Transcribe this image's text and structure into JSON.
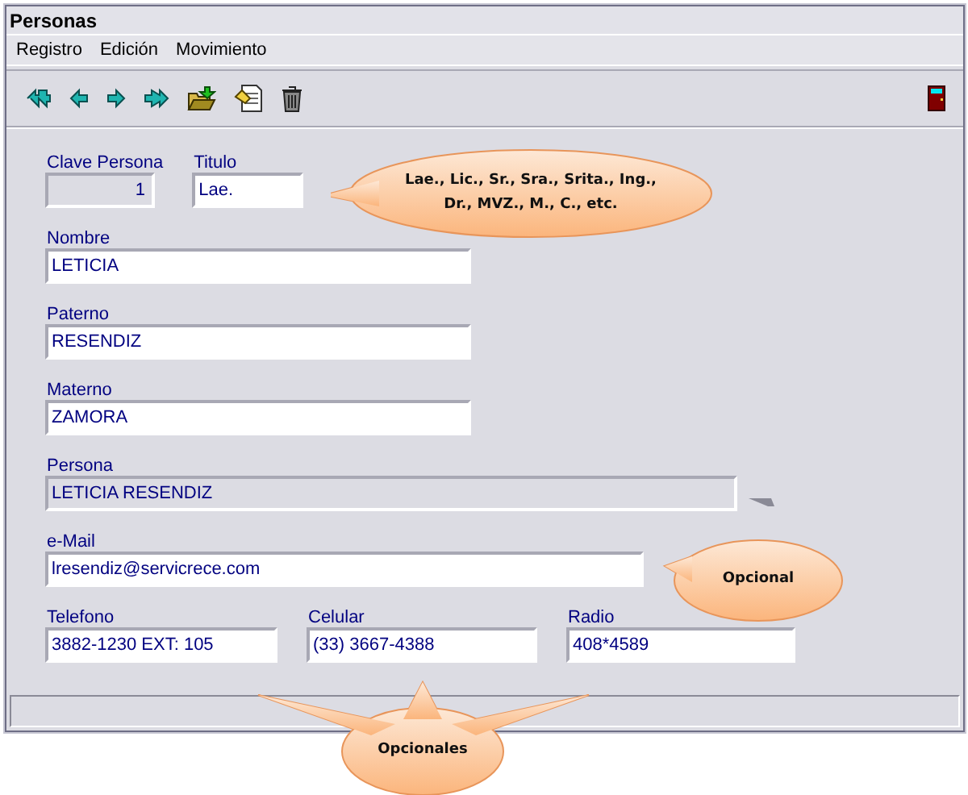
{
  "window": {
    "title": "Personas"
  },
  "menu": [
    "Registro",
    "Edición",
    "Movimiento"
  ],
  "rows": [
    [
      {
        "label": "Clave Persona",
        "value": "1",
        "kind": "number",
        "disabled": true
      },
      {
        "label": "Titulo",
        "value": "Lae.",
        "kind": "text",
        "disabled": false
      }
    ],
    [
      {
        "label": "Nombre",
        "value": "LETICIA",
        "kind": "text",
        "disabled": false
      }
    ],
    [
      {
        "label": "Paterno",
        "value": "RESENDIZ",
        "kind": "text",
        "disabled": false
      }
    ],
    [
      {
        "label": "Materno",
        "value": "ZAMORA",
        "kind": "text",
        "disabled": false
      }
    ],
    [
      {
        "label": "Persona",
        "value": "LETICIA RESENDIZ",
        "kind": "text",
        "disabled": true
      }
    ],
    [
      {
        "label": "e-Mail",
        "value": "lresendiz@servicrece.com",
        "kind": "text",
        "disabled": false
      }
    ],
    [
      {
        "label": "Telefono",
        "value": "3882-1230 EXT: 105",
        "kind": "text",
        "disabled": false
      },
      {
        "label": "Celular",
        "value": "(33) 3667-4388",
        "kind": "text",
        "disabled": false
      },
      {
        "label": "Radio",
        "value": "408*4589",
        "kind": "text",
        "disabled": false
      }
    ]
  ],
  "callouts": [
    {
      "text": "Lae., Lic., Sr., Sra., Srita., Ing., Dr., MVZ., M., C., etc."
    },
    {
      "text": "Opcional"
    },
    {
      "text": "Opcionales"
    }
  ]
}
